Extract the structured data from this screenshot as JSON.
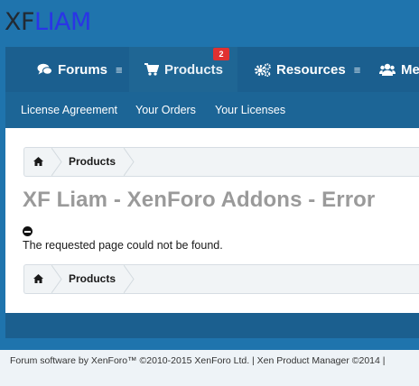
{
  "logo": {
    "part1": "XF",
    "part2": "LIAM"
  },
  "nav": {
    "tabs": [
      {
        "label": "Forums",
        "icon": "comments-icon"
      },
      {
        "label": "Products",
        "icon": "cart-icon",
        "badge": "2"
      },
      {
        "label": "Resources",
        "icon": "cogs-icon"
      },
      {
        "label": "Me",
        "icon": "members-icon"
      }
    ]
  },
  "subnav": {
    "items": [
      "License Agreement",
      "Your Orders",
      "Your Licenses"
    ]
  },
  "breadcrumb": {
    "label": "Products"
  },
  "page": {
    "title": "XF Liam - XenForo Addons - Error",
    "error_message": "The requested page could not be found."
  },
  "footer": {
    "text": "Forum software by XenForo™ ©2010-2015 XenForo Ltd. | Xen Product Manager ©2014 |"
  },
  "colors": {
    "header_bg": "#1f74ad",
    "nav_bg": "#1b5f8f",
    "badge": "#e03131",
    "logo_accent": "#2a35e6"
  }
}
